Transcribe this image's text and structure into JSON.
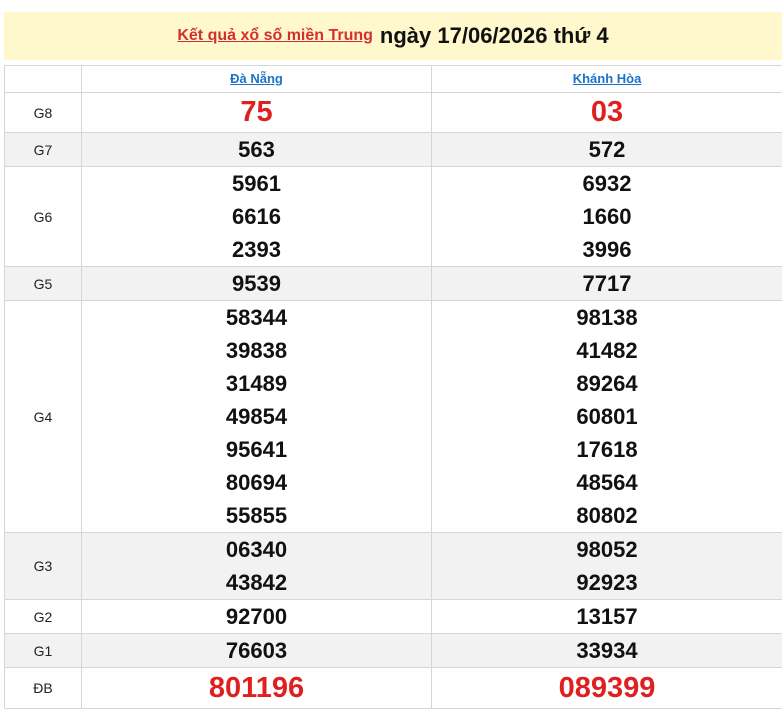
{
  "header": {
    "link_text": "Kết quả xổ số miền Trung",
    "date_text": "ngày 17/06/2026 thứ 4"
  },
  "columns": [
    {
      "label": "Đà Nẵng"
    },
    {
      "label": "Khánh Hòa"
    }
  ],
  "rows": [
    {
      "prize": "G8",
      "col1": [
        "75"
      ],
      "col2": [
        "03"
      ]
    },
    {
      "prize": "G7",
      "col1": [
        "563"
      ],
      "col2": [
        "572"
      ]
    },
    {
      "prize": "G6",
      "col1": [
        "5961",
        "6616",
        "2393"
      ],
      "col2": [
        "6932",
        "1660",
        "3996"
      ]
    },
    {
      "prize": "G5",
      "col1": [
        "9539"
      ],
      "col2": [
        "7717"
      ]
    },
    {
      "prize": "G4",
      "col1": [
        "58344",
        "39838",
        "31489",
        "49854",
        "95641",
        "80694",
        "55855"
      ],
      "col2": [
        "98138",
        "41482",
        "89264",
        "60801",
        "17618",
        "48564",
        "80802"
      ]
    },
    {
      "prize": "G3",
      "col1": [
        "06340",
        "43842"
      ],
      "col2": [
        "98052",
        "92923"
      ]
    },
    {
      "prize": "G2",
      "col1": [
        "92700"
      ],
      "col2": [
        "13157"
      ]
    },
    {
      "prize": "G1",
      "col1": [
        "76603"
      ],
      "col2": [
        "33934"
      ]
    },
    {
      "prize": "ĐB",
      "col1": [
        "801196"
      ],
      "col2": [
        "089399"
      ]
    }
  ],
  "colors": {
    "highlight": "#e02020",
    "link": "#1a73c8",
    "title_bg": "#fff8cc"
  }
}
